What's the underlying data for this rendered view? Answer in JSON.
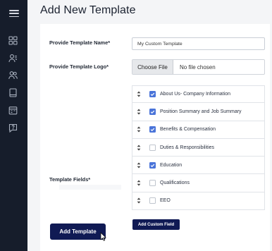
{
  "sidebar": {
    "menu_icon": "hamburger-icon",
    "items": [
      {
        "icon": "dashboard-icon"
      },
      {
        "icon": "user-list-icon"
      },
      {
        "icon": "users-icon"
      },
      {
        "icon": "book-icon"
      },
      {
        "icon": "calendar-icon"
      },
      {
        "icon": "chat-question-icon"
      }
    ]
  },
  "header": {
    "title": "Add New Template"
  },
  "form": {
    "name_label": "Provide Template Name*",
    "name_value": "My Custom Template",
    "logo_label": "Provide Template Logo*",
    "file_button": "Choose File",
    "file_status": "No file chosen",
    "fields_label": "Template Fields*",
    "fields": [
      {
        "label": "About Us- Company Information",
        "checked": true
      },
      {
        "label": "Position Summary and Job Summary",
        "checked": true
      },
      {
        "label": "Benefits & Compensation",
        "checked": true
      },
      {
        "label": "Duties & Responsibilities",
        "checked": false
      },
      {
        "label": "Education",
        "checked": true
      },
      {
        "label": "Qualifications",
        "checked": false
      },
      {
        "label": "EEO",
        "checked": false
      }
    ],
    "add_field_button": "Add Custom Field",
    "submit_button": "Add Template"
  },
  "colors": {
    "sidebar_bg": "#161d2b",
    "primary_button": "#101a54",
    "checkbox_checked": "#4a74d9"
  }
}
